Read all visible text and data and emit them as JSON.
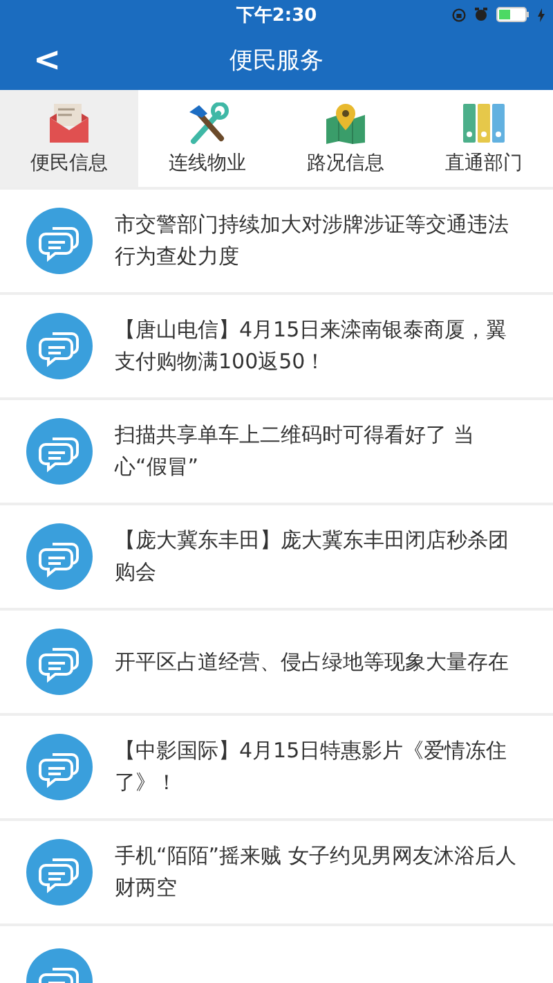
{
  "status_bar": {
    "time": "下午2:30"
  },
  "nav_bar": {
    "back": "<",
    "title": "便民服务"
  },
  "tabs": [
    {
      "label": "便民信息",
      "kind": "mail",
      "selected": true
    },
    {
      "label": "连线物业",
      "kind": "tools",
      "selected": false
    },
    {
      "label": "路况信息",
      "kind": "map",
      "selected": false
    },
    {
      "label": "直通部门",
      "kind": "folders",
      "selected": false
    }
  ],
  "news": [
    {
      "kind": "message",
      "text": "市交警部门持续加大对涉牌涉证等交通违法行为查处力度"
    },
    {
      "kind": "message",
      "text": "【唐山电信】4月15日来滦南银泰商厦，翼支付购物满100返50！"
    },
    {
      "kind": "message",
      "text": "扫描共享单车上二维码时可得看好了 当心“假冒”"
    },
    {
      "kind": "message",
      "text": "【庞大冀东丰田】庞大冀东丰田闭店秒杀团购会"
    },
    {
      "kind": "message",
      "text": "开平区占道经营、侵占绿地等现象大量存在"
    },
    {
      "kind": "message",
      "text": "【中影国际】4月15日特惠影片《爱情冻住了》！"
    },
    {
      "kind": "message",
      "text": "手机“陌陌”摇来贼 女子约见男网友沐浴后人财两空"
    },
    {
      "kind": "cut_off"
    }
  ]
}
